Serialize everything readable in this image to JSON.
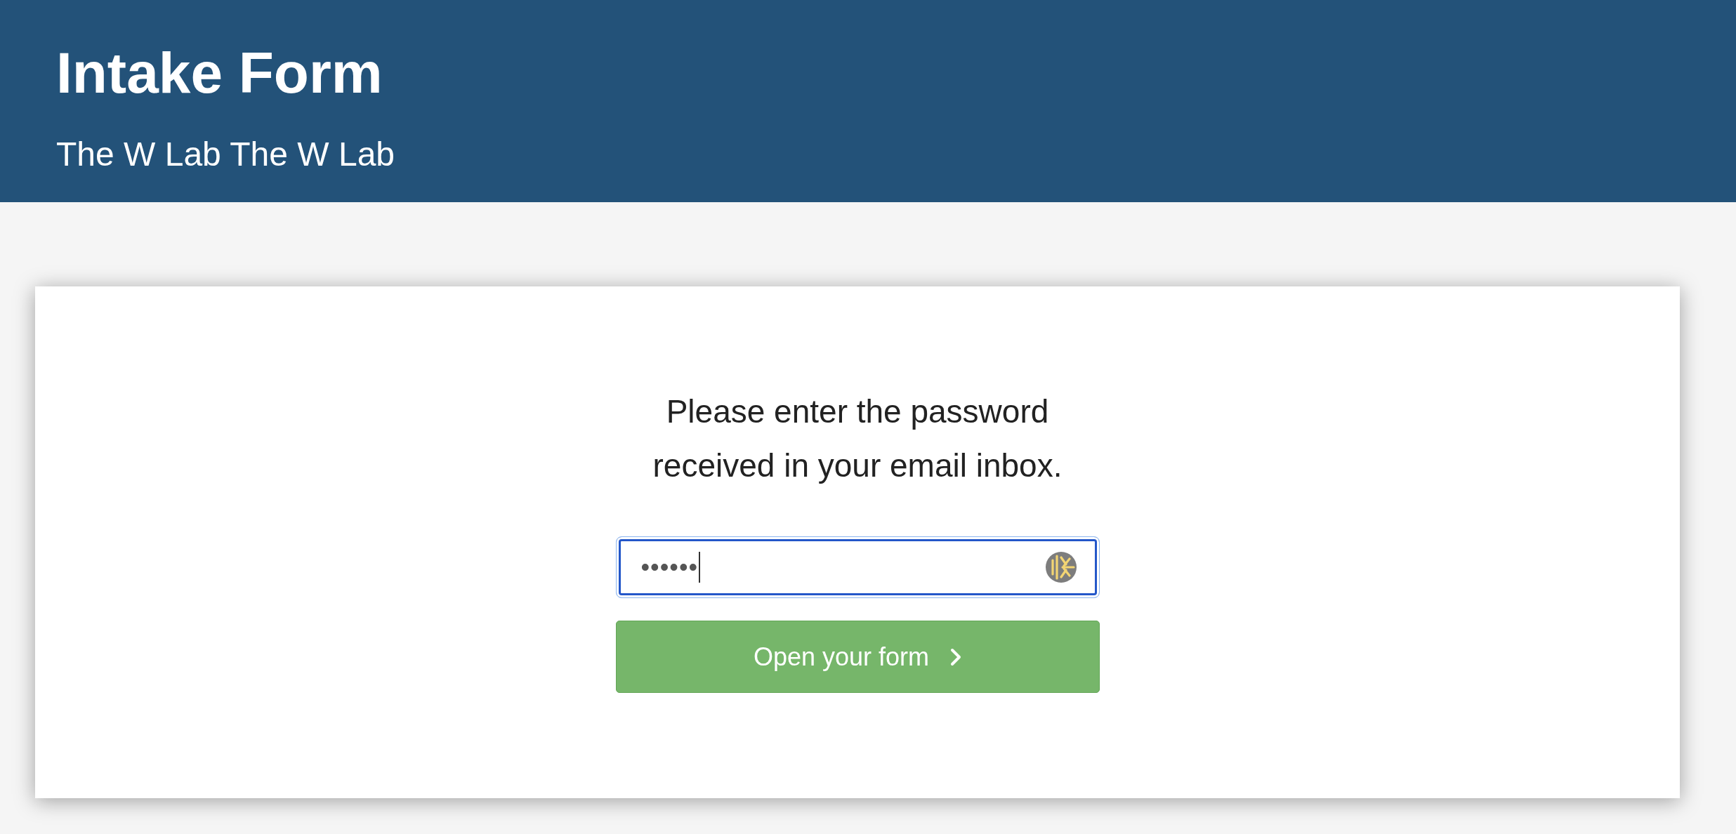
{
  "header": {
    "title": "Intake Form",
    "subtitle": "The W Lab The W Lab"
  },
  "prompt": {
    "text": "Please enter the password received in your email inbox."
  },
  "password_field": {
    "value": "••••••",
    "focused": true
  },
  "submit_button": {
    "label": "Open your form"
  }
}
